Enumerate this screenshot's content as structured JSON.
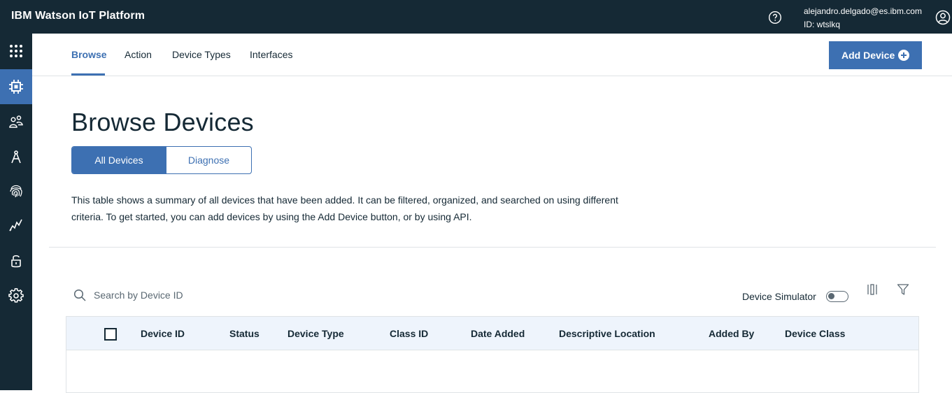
{
  "header": {
    "app_title": "IBM Watson IoT Platform",
    "help_icon": "help-icon",
    "user_email": "alejandro.delgado@es.ibm.com",
    "org_id": "ID: wtslkq",
    "user_icon": "user-icon"
  },
  "rail": {
    "items": [
      {
        "icon": "apps-grid-icon",
        "active": false
      },
      {
        "icon": "devices-chip-icon",
        "active": true
      },
      {
        "icon": "members-icon",
        "active": false
      },
      {
        "icon": "apps-compass-icon",
        "active": false
      },
      {
        "icon": "fingerprint-icon",
        "active": false
      },
      {
        "icon": "usage-chart-icon",
        "active": false
      },
      {
        "icon": "security-lock-icon",
        "active": false
      },
      {
        "icon": "settings-gear-icon",
        "active": false
      }
    ]
  },
  "subnav": {
    "tabs": [
      {
        "label": "Browse",
        "active": true
      },
      {
        "label": "Action",
        "active": false
      },
      {
        "label": "Device Types",
        "active": false
      },
      {
        "label": "Interfaces",
        "active": false
      }
    ],
    "add_device_label": "Add Device"
  },
  "page": {
    "title": "Browse Devices",
    "segments": [
      "All Devices",
      "Diagnose"
    ],
    "description": "This table shows a summary of all devices that have been added. It can be filtered, organized, and searched on using different criteria. To get started, you can add devices by using the Add Device button, or by using API."
  },
  "toolbar": {
    "search_placeholder": "Search by Device ID",
    "simulator_label": "Device Simulator",
    "simulator_on": false
  },
  "table": {
    "columns": [
      "Device ID",
      "Status",
      "Device Type",
      "Class ID",
      "Date Added",
      "Descriptive Location",
      "Added By",
      "Device Class"
    ],
    "rows": []
  },
  "colors": {
    "header_bg": "#152935",
    "accent": "#3d70b2",
    "table_header_bg": "#eef4fc"
  }
}
